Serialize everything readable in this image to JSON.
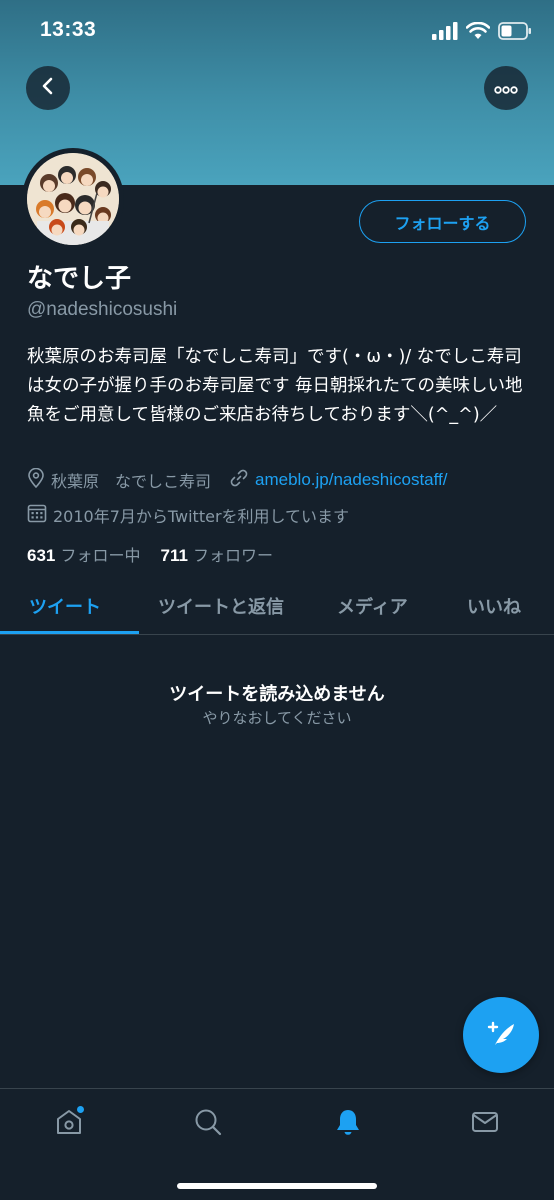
{
  "status_bar": {
    "time": "13:33"
  },
  "header": {
    "back_icon": "chevron-left-icon",
    "more_icon": "more-dots-icon"
  },
  "profile": {
    "follow_label": "フォローする",
    "display_name": "なでし子",
    "handle": "@nadeshicosushi",
    "bio": "秋葉原のお寿司屋「なでしこ寿司」です(・ω・)/ なでしこ寿司は女の子が握り手のお寿司屋です 毎日朝採れたての美味しい地魚をご用意して皆様のご来店お待ちしております＼(^_^)／",
    "location": "秋葉原　なでしこ寿司",
    "link": "ameblo.jp/nadeshicostaff/",
    "joined": "2010年7月からTwitterを利用しています",
    "following_count": "631",
    "following_label": "フォロー中",
    "followers_count": "711",
    "followers_label": "フォロワー"
  },
  "tabs": [
    {
      "label": "ツイート",
      "active": true
    },
    {
      "label": "ツイートと返信",
      "active": false
    },
    {
      "label": "メディア",
      "active": false
    },
    {
      "label": "いいね",
      "active": false
    }
  ],
  "empty_state": {
    "title": "ツイートを読み込めません",
    "subtitle": "やりなおしてください"
  },
  "fab": {
    "icon": "compose-tweet-icon"
  },
  "bottom_nav": [
    {
      "icon": "home-icon",
      "badge": true
    },
    {
      "icon": "search-icon",
      "badge": false
    },
    {
      "icon": "notifications-bell-icon",
      "badge": false,
      "active": true
    },
    {
      "icon": "messages-envelope-icon",
      "badge": false
    }
  ],
  "colors": {
    "background": "#15202b",
    "accent": "#1da1f2",
    "secondary_text": "#8899a6",
    "divider": "#38444d"
  }
}
